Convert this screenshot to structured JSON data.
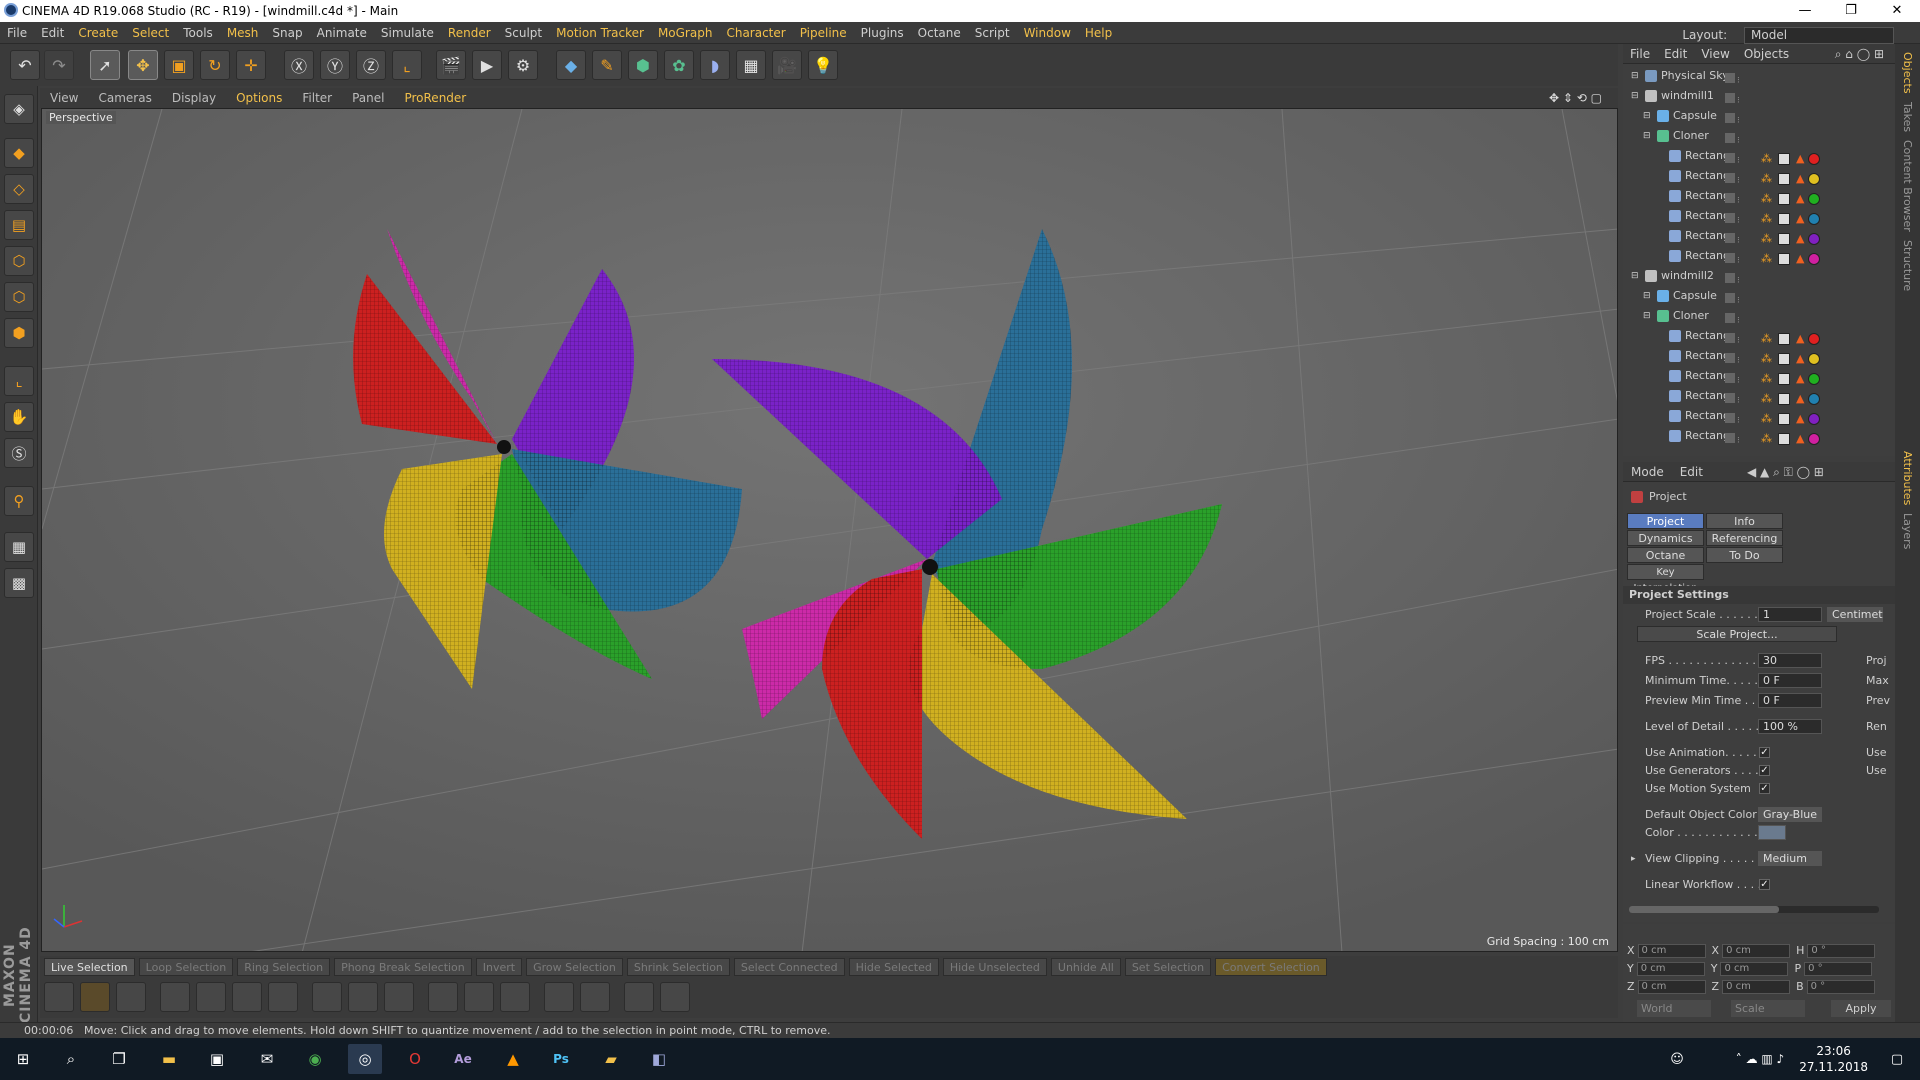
{
  "window": {
    "title": "CINEMA 4D R19.068 Studio (RC - R19) - [windmill.c4d *] - Main"
  },
  "menu": [
    "File",
    "Edit",
    "Create",
    "Select",
    "Tools",
    "Mesh",
    "Snap",
    "Animate",
    "Simulate",
    "Render",
    "Sculpt",
    "Motion Tracker",
    "MoGraph",
    "Character",
    "Pipeline",
    "Plugins",
    "Octane",
    "Script",
    "Window",
    "Help"
  ],
  "layout": {
    "label": "Layout:",
    "value": "Model"
  },
  "viewport": {
    "menu": [
      "View",
      "Cameras",
      "Display",
      "Options",
      "Filter",
      "Panel",
      "ProRender"
    ],
    "label": "Perspective",
    "grid_spacing": "Grid Spacing : 100 cm"
  },
  "selection_bar": [
    "Live Selection",
    "Loop Selection",
    "Ring Selection",
    "Phong Break Selection",
    "Invert",
    "Grow Selection",
    "Shrink Selection",
    "Select Connected",
    "Hide Selected",
    "Hide Unselected",
    "Unhide All",
    "Set Selection",
    "Convert Selection"
  ],
  "status": {
    "time": "00:00:06",
    "message": "Move: Click and drag to move elements. Hold down SHIFT to quantize movement / add to the selection in point mode, CTRL to remove."
  },
  "object_manager": {
    "menu": [
      "File",
      "Edit",
      "View",
      "Objects"
    ],
    "objects": [
      {
        "name": "Physical Sky",
        "indent": 0,
        "icon": "#7a9ac0"
      },
      {
        "name": "windmill1",
        "indent": 0,
        "icon": "#c0c0c0"
      },
      {
        "name": "Capsule",
        "indent": 1,
        "icon": "#6ab0e8"
      },
      {
        "name": "Cloner",
        "indent": 1,
        "icon": "#58c090"
      },
      {
        "name": "Rectangle",
        "indent": 2,
        "icon": "#8aa8d8",
        "color": "#e02020"
      },
      {
        "name": "Rectangle",
        "indent": 2,
        "icon": "#8aa8d8",
        "color": "#e0c020"
      },
      {
        "name": "Rectangle",
        "indent": 2,
        "icon": "#8aa8d8",
        "color": "#20b020"
      },
      {
        "name": "Rectangle",
        "indent": 2,
        "icon": "#8aa8d8",
        "color": "#2080b0"
      },
      {
        "name": "Rectangle",
        "indent": 2,
        "icon": "#8aa8d8",
        "color": "#8020c0"
      },
      {
        "name": "Rectangle",
        "indent": 2,
        "icon": "#8aa8d8",
        "color": "#d020a0"
      },
      {
        "name": "windmill2",
        "indent": 0,
        "icon": "#c0c0c0"
      },
      {
        "name": "Capsule",
        "indent": 1,
        "icon": "#6ab0e8"
      },
      {
        "name": "Cloner",
        "indent": 1,
        "icon": "#58c090"
      },
      {
        "name": "Rectangle",
        "indent": 2,
        "icon": "#8aa8d8",
        "color": "#e02020"
      },
      {
        "name": "Rectangle",
        "indent": 2,
        "icon": "#8aa8d8",
        "color": "#e0c020"
      },
      {
        "name": "Rectangle",
        "indent": 2,
        "icon": "#8aa8d8",
        "color": "#20b020"
      },
      {
        "name": "Rectangle",
        "indent": 2,
        "icon": "#8aa8d8",
        "color": "#2080b0"
      },
      {
        "name": "Rectangle",
        "indent": 2,
        "icon": "#8aa8d8",
        "color": "#8020c0"
      },
      {
        "name": "Rectangle",
        "indent": 2,
        "icon": "#8aa8d8",
        "color": "#d020a0"
      }
    ]
  },
  "attributes": {
    "menu": [
      "Mode",
      "Edit"
    ],
    "header": "Project",
    "tabs": [
      "Project Settings",
      "Info",
      "Dynamics",
      "Referencing",
      "Octane Render",
      "To Do",
      "Key Interpolation"
    ],
    "section": "Project Settings",
    "project_scale": {
      "label": "Project Scale . . . . . .",
      "value": "1",
      "unit": "Centimet"
    },
    "scale_button": "Scale Project...",
    "fps": {
      "label": "FPS . . . . . . . . . . . . .",
      "value": "30",
      "right": "Proj"
    },
    "min_time": {
      "label": "Minimum Time. . . . . .",
      "value": "0 F",
      "right": "Max"
    },
    "preview_min": {
      "label": "Preview Min Time . . .",
      "value": "0 F",
      "right": "Prev"
    },
    "lod": {
      "label": "Level of Detail . . . . .",
      "value": "100 %",
      "right": "Ren"
    },
    "use_animation": {
      "label": "Use Animation. . . . . .",
      "right": "Use"
    },
    "use_generators": {
      "label": "Use Generators . . . .",
      "right": "Use"
    },
    "use_motion": {
      "label": "Use Motion System"
    },
    "default_color": {
      "label": "Default Object Color",
      "value": "Gray-Blue"
    },
    "color": {
      "label": "Color . . . . . . . . . . . ."
    },
    "view_clipping": {
      "label": "View Clipping . . . . . .",
      "value": "Medium"
    },
    "linear_workflow": {
      "label": "Linear Workflow . . . ."
    }
  },
  "coords": {
    "rows": [
      {
        "a": "X",
        "av": "0 cm",
        "b": "X",
        "bv": "0 cm",
        "c": "H",
        "cv": "0 °"
      },
      {
        "a": "Y",
        "av": "0 cm",
        "b": "Y",
        "bv": "0 cm",
        "c": "P",
        "cv": "0 °"
      },
      {
        "a": "Z",
        "av": "0 cm",
        "b": "Z",
        "bv": "0 cm",
        "c": "B",
        "cv": "0 °"
      }
    ],
    "world": "World",
    "scale": "Scale",
    "apply": "Apply"
  },
  "side_tabs": [
    "Objects",
    "Takes",
    "Content Browser",
    "Structure",
    "Attributes",
    "Layers"
  ],
  "taskbar": {
    "time": "23:06",
    "date": "27.11.2018"
  },
  "branding": "MAXON CINEMA 4D"
}
